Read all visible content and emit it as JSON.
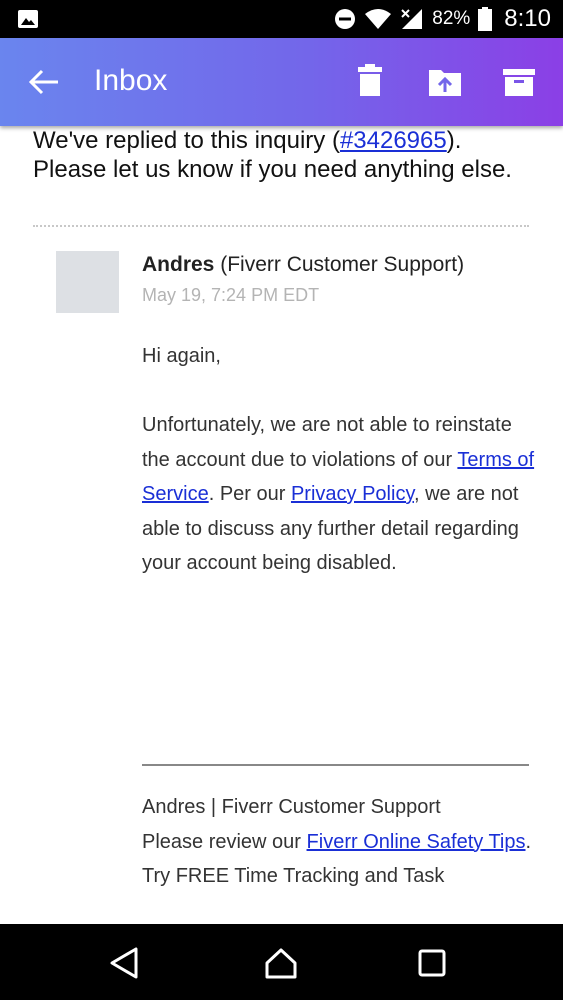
{
  "status_bar": {
    "battery_percent": "82%",
    "time": "8:10"
  },
  "app_bar": {
    "title": "Inbox"
  },
  "intro": {
    "line1_prefix": "We've replied to this inquiry (",
    "ticket_link": "#3426965",
    "line1_suffix": ").",
    "line2": "Please let us know if you need anything else."
  },
  "message": {
    "sender_name": "Andres",
    "sender_org": "(Fiverr Customer Support)",
    "date": "May 19, 7:24 PM EDT",
    "greeting": "Hi again,",
    "para_part1": "Unfortunately, we are not able to reinstate the account due to violations of our ",
    "tos_link": "Terms of Service",
    "para_part2": ". Per our ",
    "privacy_link": "Privacy Policy",
    "para_part3": ", we are not able to discuss any further detail regarding your account being disabled."
  },
  "signature": {
    "line1": "Andres | Fiverr Customer Support",
    "line2_prefix": "Please review our ",
    "safety_link": "Fiverr Online Safety Tips",
    "line2_suffix": ".",
    "line3": "Try FREE Time Tracking and Task"
  },
  "icons": [
    "gallery-icon",
    "dnd-icon",
    "wifi-icon",
    "signal-icon",
    "battery-icon",
    "back-arrow-icon",
    "trash-icon",
    "move-to-folder-icon",
    "archive-icon",
    "nav-back-icon",
    "nav-home-icon",
    "nav-recents-icon"
  ]
}
